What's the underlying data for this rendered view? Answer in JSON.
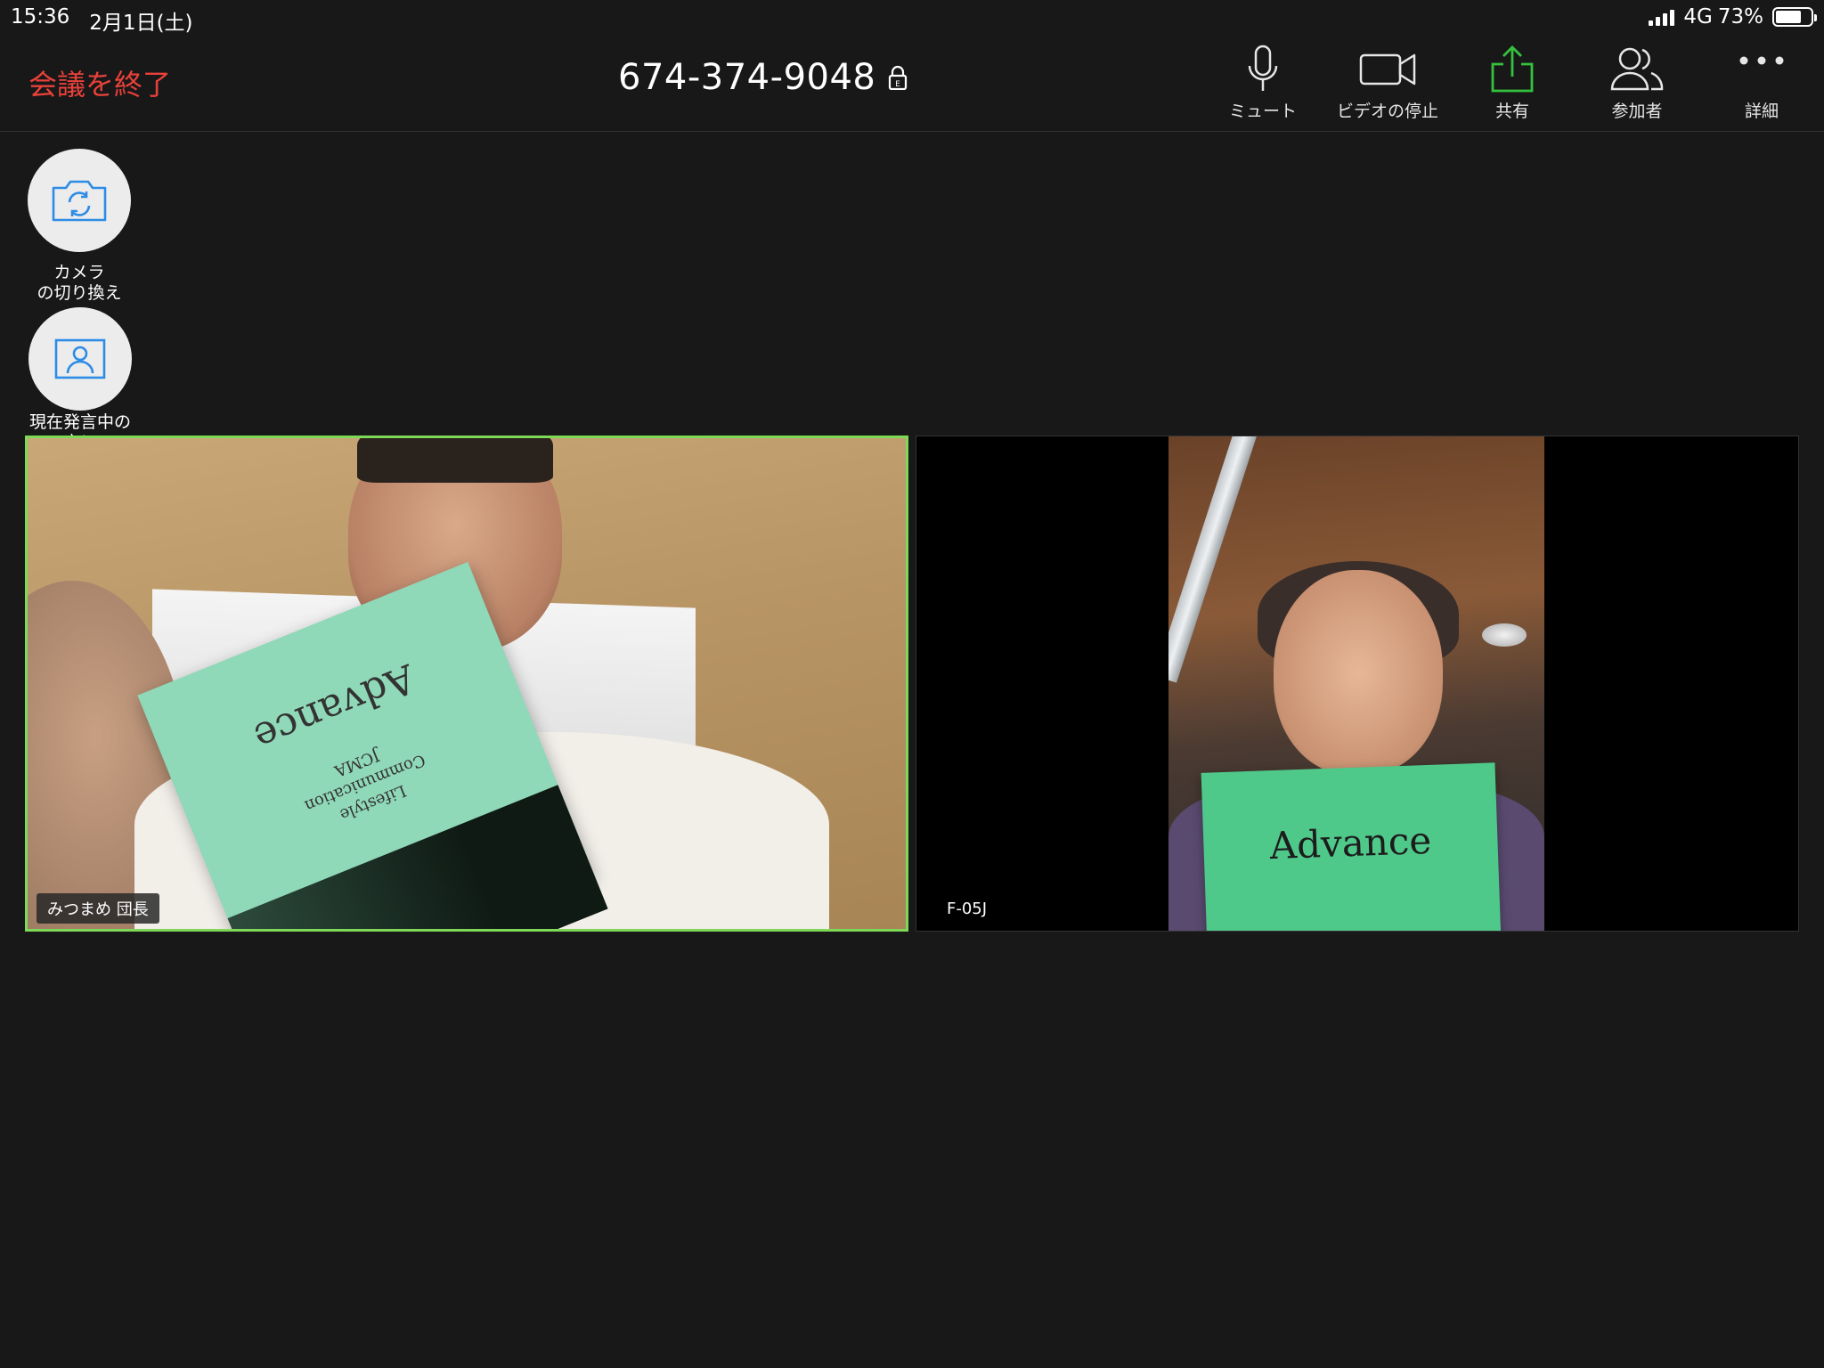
{
  "status_bar": {
    "time": "15:36",
    "date": "2月1日(土)",
    "network": "4G",
    "battery": "73%",
    "battery_level": 0.73
  },
  "header": {
    "end_meeting_label": "会議を終了",
    "meeting_id": "674-374-9048",
    "lock_badge": "E"
  },
  "toolbar": [
    {
      "label": "ミュート",
      "icon": "microphone-icon"
    },
    {
      "label": "ビデオの停止",
      "icon": "video-camera-icon"
    },
    {
      "label": "共有",
      "icon": "share-icon"
    },
    {
      "label": "参加者",
      "icon": "participants-icon"
    },
    {
      "label": "詳細",
      "icon": "more-icon"
    }
  ],
  "side_buttons": {
    "switch_camera": {
      "label": "カメラ\nの切り換え",
      "icon": "camera-switch-icon"
    },
    "active_speaker": {
      "label": "現在発言中の\n方に\n切り替える",
      "icon": "speaker-view-icon"
    }
  },
  "videos": [
    {
      "name": "みつまめ 団長",
      "book_title": "Advance",
      "book_subtitle_1": "Lifestyle",
      "book_subtitle_2": "Communication",
      "book_subtitle_3": "JCMA"
    },
    {
      "name": "F-05J",
      "book_title": "Advance"
    }
  ],
  "colors": {
    "end_meeting": "#e8413a",
    "share_green": "#35c13e",
    "active_border": "#7ed957",
    "background": "#181818"
  }
}
